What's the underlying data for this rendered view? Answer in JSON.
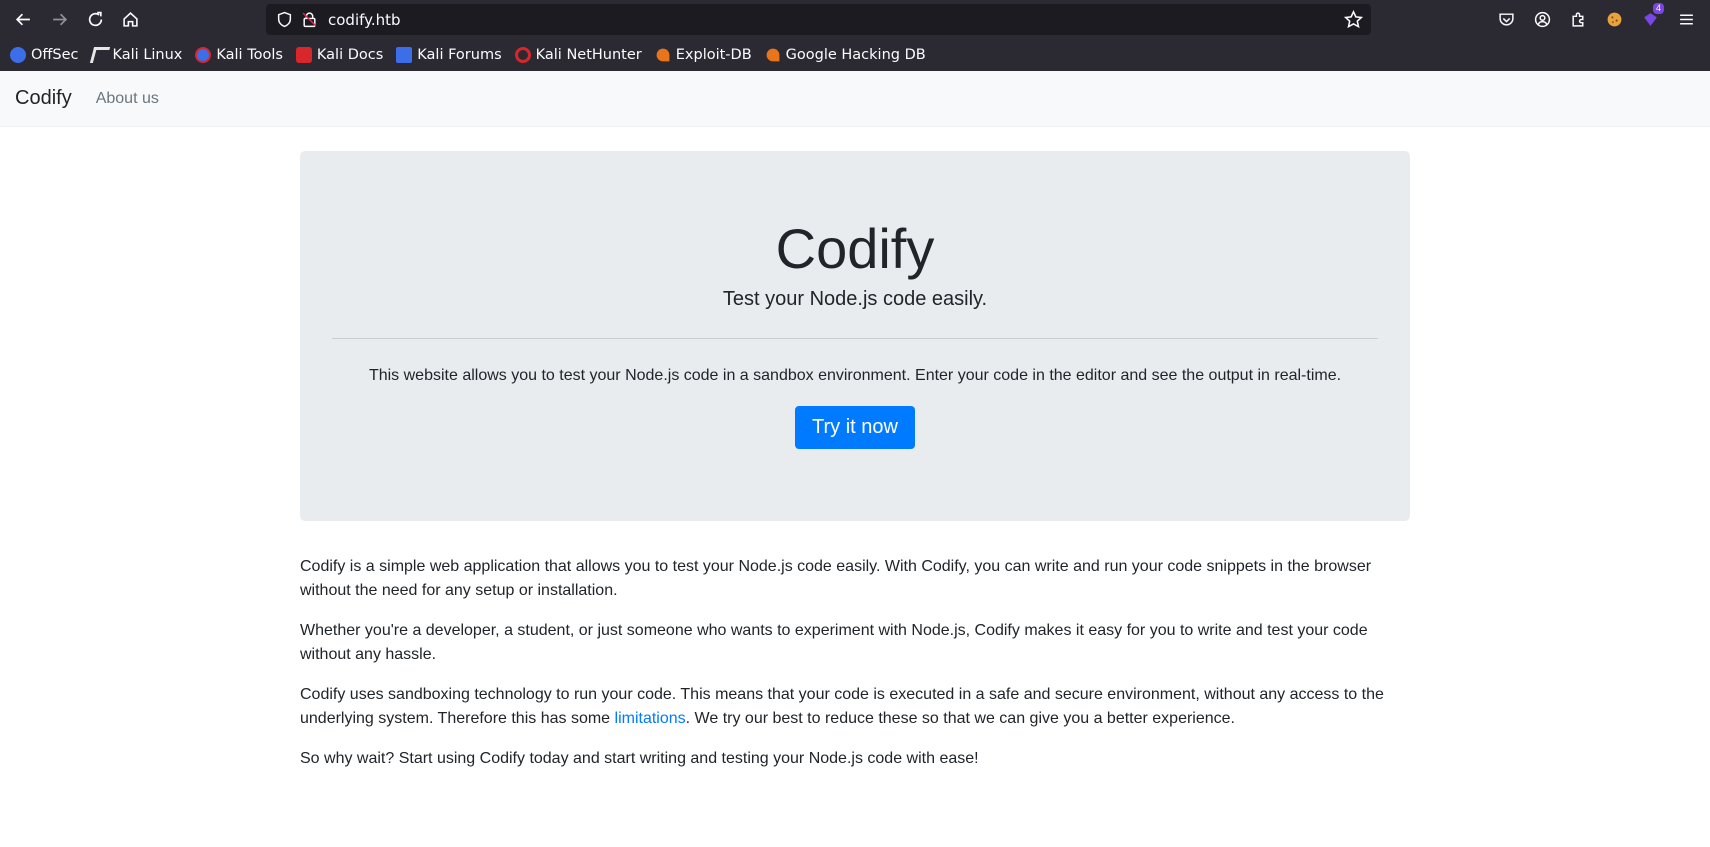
{
  "browser": {
    "url": "codify.htb",
    "extensions_badge": "4",
    "bookmarks": [
      {
        "label": "OffSec",
        "color": "#3b6ee8"
      },
      {
        "label": "Kali Linux",
        "color": "#e6e6e6"
      },
      {
        "label": "Kali Tools",
        "color": "#3b6ee8"
      },
      {
        "label": "Kali Docs",
        "color": "#d9262a"
      },
      {
        "label": "Kali Forums",
        "color": "#3b6ee8"
      },
      {
        "label": "Kali NetHunter",
        "color": "#d9262a"
      },
      {
        "label": "Exploit-DB",
        "color": "#e8741b"
      },
      {
        "label": "Google Hacking DB",
        "color": "#e8741b"
      }
    ]
  },
  "navbar": {
    "brand": "Codify",
    "about": "About us"
  },
  "jumbotron": {
    "title": "Codify",
    "lead": "Test your Node.js code easily.",
    "text": "This website allows you to test your Node.js code in a sandbox environment. Enter your code in the editor and see the output in real-time.",
    "button": "Try it now"
  },
  "content": {
    "p1": "Codify is a simple web application that allows you to test your Node.js code easily. With Codify, you can write and run your code snippets in the browser without the need for any setup or installation.",
    "p2": "Whether you're a developer, a student, or just someone who wants to experiment with Node.js, Codify makes it easy for you to write and test your code without any hassle.",
    "p3_before": "Codify uses sandboxing technology to run your code. This means that your code is executed in a safe and secure environment, without any access to the underlying system. Therefore this has some ",
    "p3_link": "limitations",
    "p3_after": ". We try our best to reduce these so that we can give you a better experience.",
    "p4": "So why wait? Start using Codify today and start writing and testing your Node.js code with ease!"
  },
  "colors": {
    "accent": "#007bff",
    "chrome_bg": "#2b2a33",
    "jumbotron_bg": "#e9ecef"
  }
}
